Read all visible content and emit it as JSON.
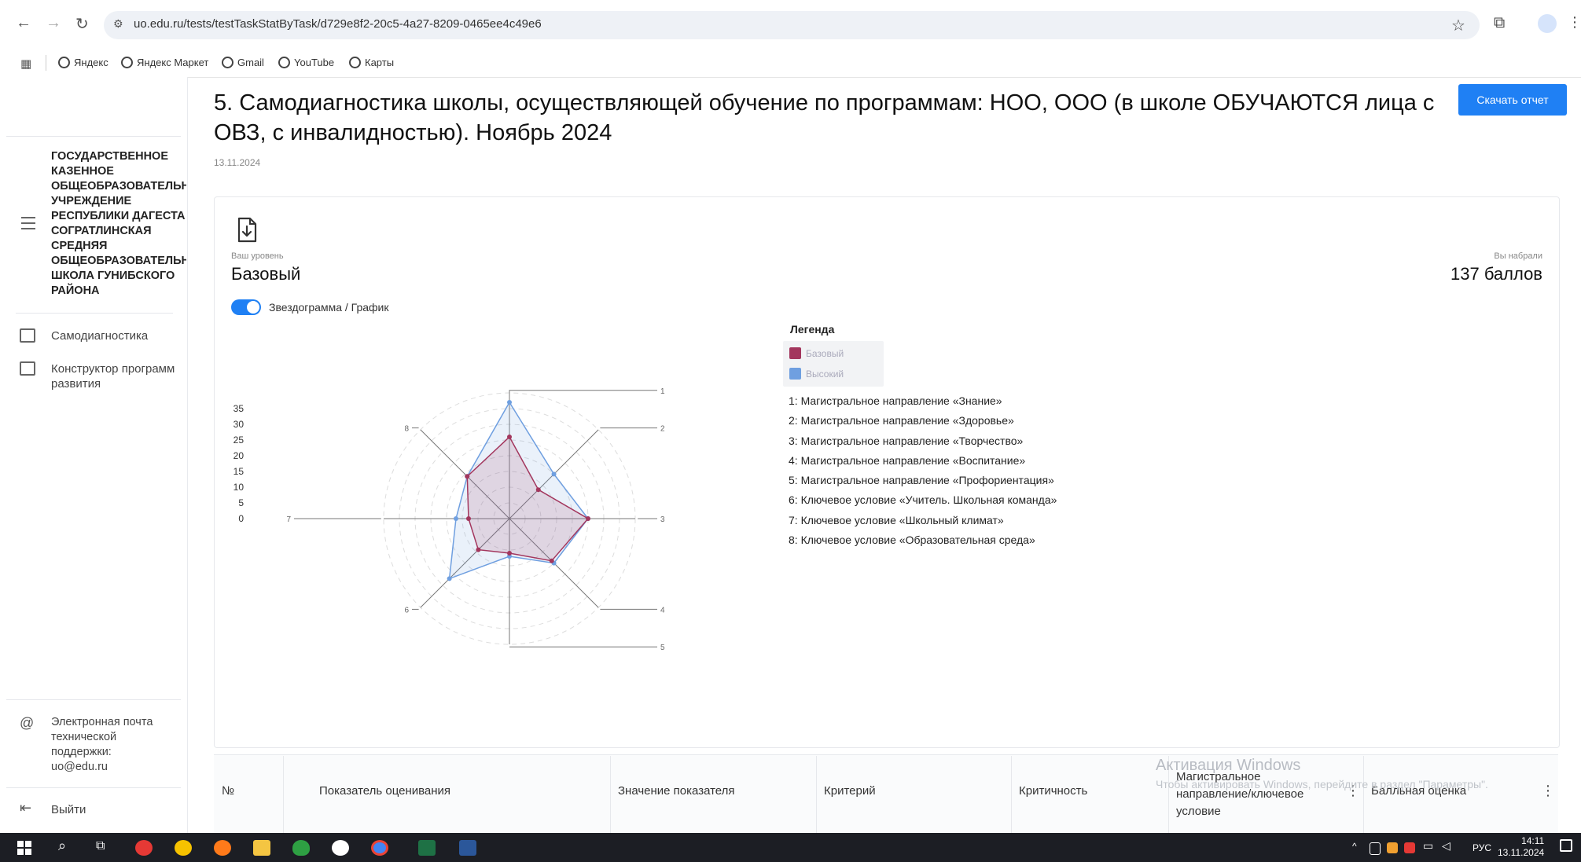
{
  "browser": {
    "url": "uo.edu.ru/tests/testTaskStatByTask/d729e8f2-20c5-4a27-8209-0465ee4c49e6",
    "bookmarks": [
      "Яндекс",
      "Яндекс Маркет",
      "Gmail",
      "YouTube",
      "Карты"
    ]
  },
  "sidebar": {
    "org_name": "ГОСУДАРСТВЕННОЕ\nКАЗЕННОЕ\nОБЩЕОБРАЗОВАТЕЛЬН\nУЧРЕЖДЕНИЕ\nРЕСПУБЛИКИ ДАГЕСТА\nСОГРАТЛИНСКАЯ\nСРЕДНЯЯ\nОБЩЕОБРАЗОВАТЕЛЬН\nШКОЛА ГУНИБСКОГО\nРАЙОНА",
    "items": [
      {
        "label": "Самодиагностика"
      },
      {
        "label": "Конструктор программ развития"
      }
    ],
    "support": "Электронная почта технической поддержки: uo@edu.ru",
    "logout": "Выйти"
  },
  "main": {
    "title": "5. Самодиагностика школы, осуществляющей обучение по программам: НОО, ООО (в школе ОБУЧАЮТСЯ лица с ОВЗ, с инвалидностью). Ноябрь 2024",
    "report_button": "Скачать отчет",
    "date": "13.11.2024",
    "level_label": "Ваш уровень",
    "level_value": "Базовый",
    "score_label": "Вы набрали",
    "score_value": "137 баллов",
    "toggle_label": "Звездограмма / График",
    "toggle_on": true,
    "legend_title": "Легенда",
    "legend": [
      {
        "name": "Базовый",
        "color": "#a3365d"
      },
      {
        "name": "Высокий",
        "color": "#6f9fe0"
      }
    ],
    "axis_descriptions": [
      "1: Магистральное направление «Знание»",
      "2: Магистральное направление «Здоровье»",
      "3: Магистральное направление «Творчество»",
      "4: Магистральное направление «Воспитание»",
      "5: Магистральное направление «Профориентация»",
      "6: Ключевое условие «Учитель. Школьная команда»",
      "7: Ключевое условие «Школьный климат»",
      "8: Ключевое условие «Образовательная среда»"
    ]
  },
  "chart_data": {
    "type": "radar",
    "axes": [
      "1",
      "2",
      "3",
      "4",
      "5",
      "6",
      "7",
      "8"
    ],
    "r_ticks": [
      0,
      5,
      10,
      15,
      20,
      25,
      30,
      35
    ],
    "rlim": [
      0,
      40
    ],
    "series": [
      {
        "name": "Базовый",
        "color": "#a3365d",
        "values": [
          26,
          13,
          25,
          19,
          11,
          14,
          13,
          19
        ]
      },
      {
        "name": "Высокий",
        "color": "#6f9fe0",
        "values": [
          37,
          20,
          25,
          20,
          12,
          27,
          17,
          19
        ]
      }
    ]
  },
  "table": {
    "headers": [
      "№",
      "Показатель оценивания",
      "Значение показателя",
      "Критерий",
      "Критичность",
      "Магистральное направление/ключевое условие",
      "Балльная оценка"
    ]
  },
  "watermark": {
    "line1": "Активация Windows",
    "line2": "Чтобы активировать Windows, перейдите в раздел \"Параметры\"."
  },
  "taskbar": {
    "lang": "РУС",
    "time": "14:11",
    "date": "13.11.2024"
  }
}
